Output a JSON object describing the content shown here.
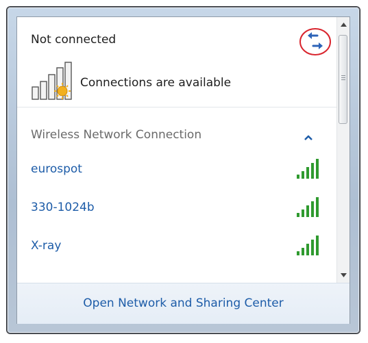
{
  "header": {
    "status_title": "Not connected"
  },
  "connection_status": {
    "message": "Connections are available"
  },
  "section": {
    "title": "Wireless Network Connection"
  },
  "networks": [
    {
      "name": "eurospot"
    },
    {
      "name": "330-1024b"
    },
    {
      "name": "X-ray"
    }
  ],
  "footer": {
    "link_label": "Open Network and Sharing Center"
  },
  "colors": {
    "link": "#1d5ca8",
    "signal": "#2f9a2f",
    "highlight_circle": "#d9252e"
  }
}
